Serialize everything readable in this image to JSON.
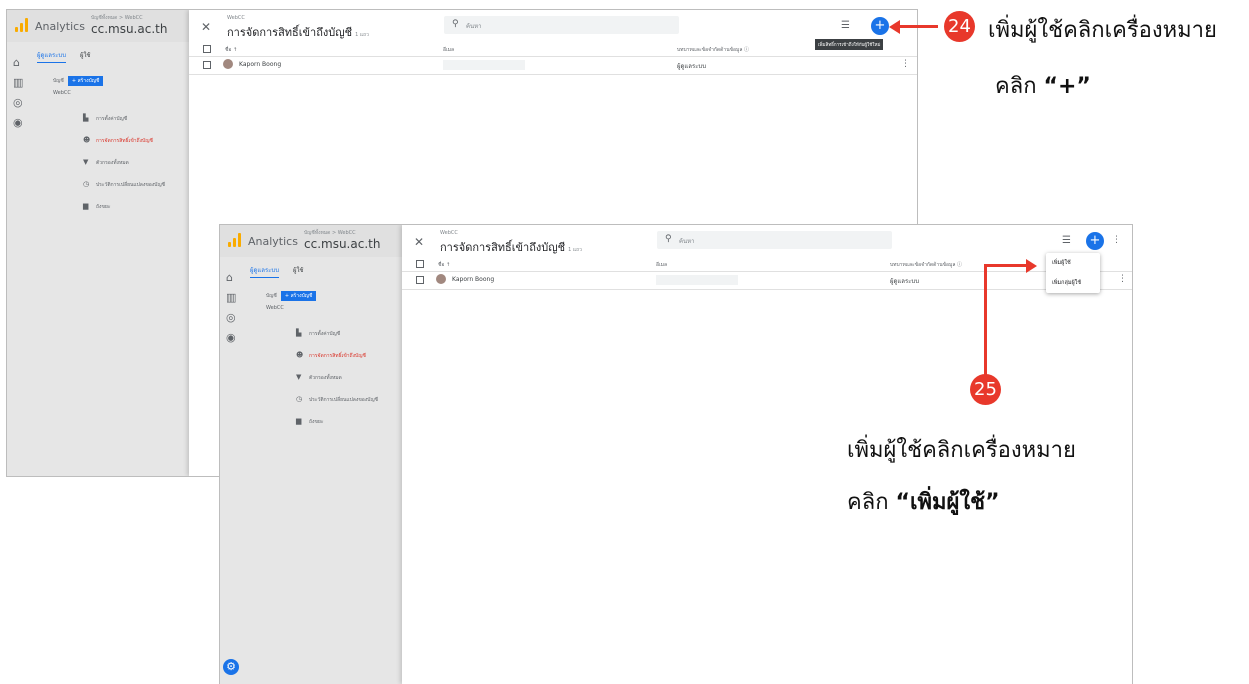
{
  "ga": {
    "app_title": "Analytics",
    "breadcrumb": "บัญชีทั้งหมด > WebCC",
    "property": "cc.msu.ac.th",
    "tabs": [
      "ผู้ดูแลระบบ",
      "ผู้ใช้"
    ],
    "account_label": "บัญชี",
    "add_account": "+ สร้างบัญชี",
    "account_name": "WebCC",
    "menu": [
      "การตั้งค่าบัญชี",
      "การจัดการสิทธิ์เข้าถึงบัญชี",
      "ตัวกรองทั้งหมด",
      "ประวัติการเปลี่ยนแปลงของบัญชี",
      "ถังขยะ"
    ]
  },
  "panel": {
    "account_small": "WebCC",
    "title": "การจัดการสิทธิ์เข้าถึงบัญชี",
    "count": "1 แถว",
    "search_placeholder": "ค้นหา",
    "col_name": "ชื่อ ↑",
    "col_email": "อีเมล",
    "col_role": "บทบาทและข้อจำกัดด้านข้อมูล ⓘ",
    "row_name": "Kaporn Boong",
    "row_role": "ผู้ดูแลระบบ",
    "tooltip": "เพิ่มสิทธิ์การเข้าถึงให้กับผู้ใช้ใหม่",
    "dropdown": [
      "เพิ่มผู้ใช้",
      "เพิ่มกลุ่มผู้ใช้"
    ]
  },
  "annotations": {
    "step1_num": "24",
    "step1_line1": "เพิ่มผู้ใช้คลิกเครื่องหมาย",
    "step1_line2_prefix": "คลิก ",
    "step1_line2_bold": "“+”",
    "step2_num": "25",
    "step2_line1": "เพิ่มผู้ใช้คลิกเครื่องหมาย",
    "step2_line2_prefix": "คลิก ",
    "step2_line2_bold": "“เพิ่มผู้ใช้”"
  },
  "colors": {
    "accent": "#1a73e8",
    "annotation_red": "#e8382b",
    "logo": "#f9ab00"
  }
}
